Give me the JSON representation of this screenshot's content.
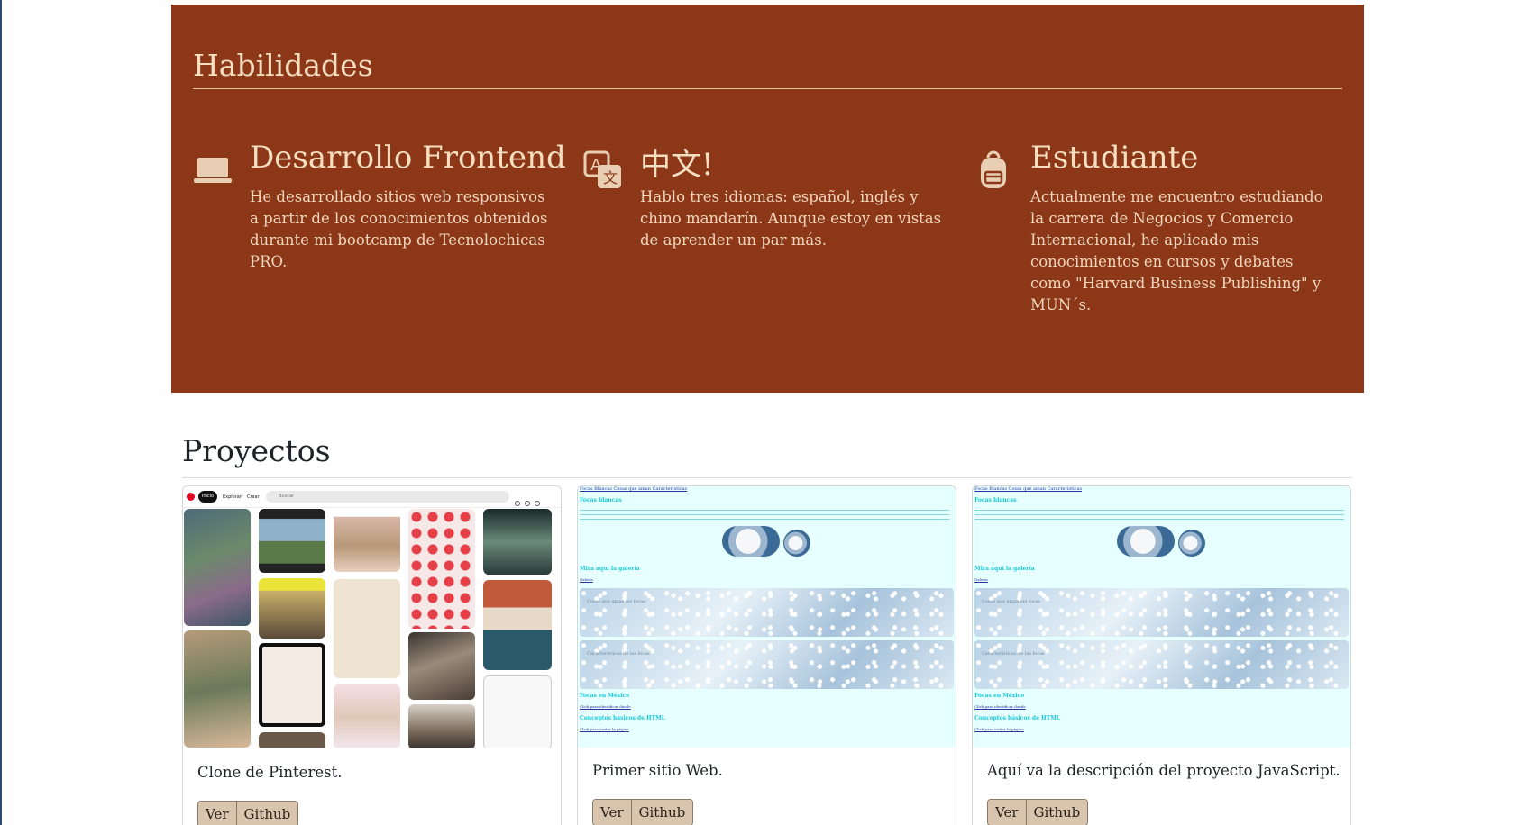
{
  "skills": {
    "title": "Habilidades",
    "background": "#8b3718",
    "items": [
      {
        "icon": "laptop-icon",
        "title": "Desarrollo Frontend",
        "text": "He desarrollado sitios web responsivos a partir de los conocimientos obtenidos durante mi bootcamp de Tecnolochicas PRO."
      },
      {
        "icon": "translate-icon",
        "title": "中文!",
        "text": "Hablo tres idiomas: español, inglés y chino mandarín. Aunque estoy en vistas de aprender un par más."
      },
      {
        "icon": "backpack-icon",
        "title": "Estudiante",
        "text": "Actualmente me encuentro estudiando la carrera de Negocios y Comercio Internacional, he aplicado mis conocimientos en cursos y debates como \"Harvard Business Publishing\" y MUN´s."
      }
    ]
  },
  "projects": {
    "title": "Proyectos",
    "cards": [
      {
        "description": "Clone de Pinterest.",
        "view_label": "Ver",
        "github_label": "Github",
        "thumb": {
          "home": "Inicio",
          "explore": "Explorar",
          "create": "Crear",
          "search_placeholder": "Buscar"
        }
      },
      {
        "description": "Primer sitio Web.",
        "view_label": "Ver",
        "github_label": "Github",
        "thumb": {
          "nav": "Focas Blancas Cosas que aman Características",
          "h1": "Focas blancas",
          "h2": "Mira aquí la galería",
          "link1": "Galería",
          "box1": "Cosas que aman las focas",
          "box2": "Características de las focas",
          "h3": "Focas en México",
          "link2": "Click para identificar donde",
          "h4": "Conceptos básicos de HTML",
          "link3": "Click para visitar la página"
        }
      },
      {
        "description": "Aquí va la descripción del proyecto JavaScript.",
        "view_label": "Ver",
        "github_label": "Github",
        "thumb": {
          "nav": "Focas Blancas Cosas que aman Características",
          "h1": "Focas blancas",
          "h2": "Mira aquí la galería",
          "link1": "Galería",
          "box1": "Cosas que aman las focas",
          "box2": "Características de las focas",
          "h3": "Focas en México",
          "link2": "Click para identificar donde",
          "h4": "Conceptos básicos de HTML",
          "link3": "Click para visitar la página"
        }
      }
    ]
  },
  "colors": {
    "accent": "#8b3718",
    "button": "#d9c4ae",
    "heading_light": "#f5dfc0"
  }
}
